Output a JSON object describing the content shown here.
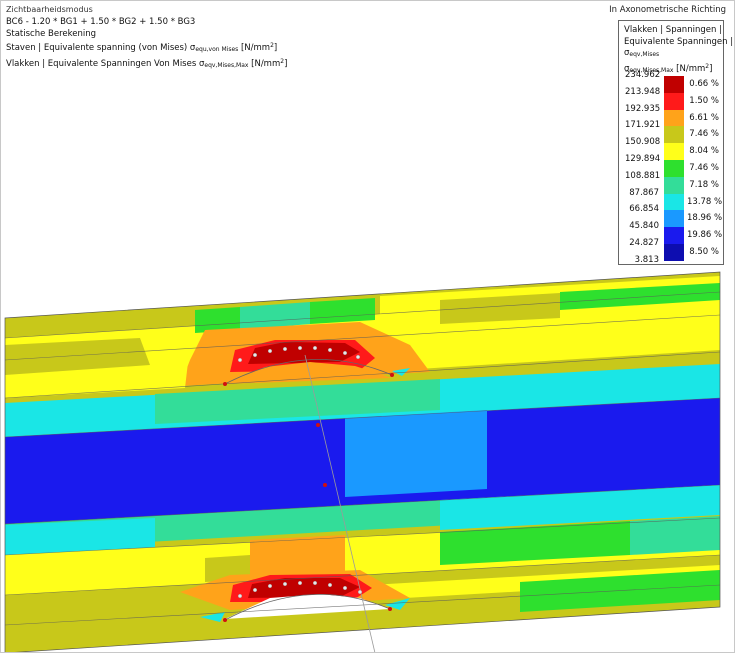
{
  "header": {
    "line1": "Zichtbaarheidsmodus",
    "line2": "BC6 - 1.20 * BG1 + 1.50 * BG2 + 1.50 * BG3",
    "line3": "Statische Berekening",
    "line4_pre": "Staven | Equivalente spanning (von Mises) σ",
    "line4_sub": "equ,von Mises",
    "line4_post": " [N/mm",
    "line4_sup": "2",
    "line4_end": "]",
    "line5_pre": "Vlakken | Equivalente Spanningen Von Mises σ",
    "line5_sub": "eqv,Mises,Max",
    "line5_post": " [N/mm",
    "line5_sup": "2",
    "line5_end": "]"
  },
  "view_direction": "In Axonometrische Richting",
  "legend": {
    "title1": "Vlakken | Spanningen |",
    "title2": "Equivalente Spanningen |",
    "title3_main": "σ",
    "title3_sub": "eqv,Mises",
    "title4_main": "σ",
    "title4_sub": "eqv,Mises,Max",
    "title4_unit": " [N/mm",
    "title4_sup": "2",
    "title4_end": "]",
    "values": [
      "234.962",
      "213.948",
      "192.935",
      "171.921",
      "150.908",
      "129.894",
      "108.881",
      "87.867",
      "66.854",
      "45.840",
      "24.827",
      "3.813"
    ],
    "percents": [
      "0.66 %",
      "1.50 %",
      "6.61 %",
      "7.46 %",
      "8.04 %",
      "7.46 %",
      "7.18 %",
      "13.78 %",
      "18.96 %",
      "19.86 %",
      "8.50 %"
    ],
    "colors": [
      "#c00000",
      "#ff1a1a",
      "#ffa31a",
      "#c8c81a",
      "#ffff1a",
      "#2ee02e",
      "#33dd99",
      "#1ae6e6",
      "#1a99ff",
      "#1a1aee",
      "#0d0db0"
    ]
  }
}
